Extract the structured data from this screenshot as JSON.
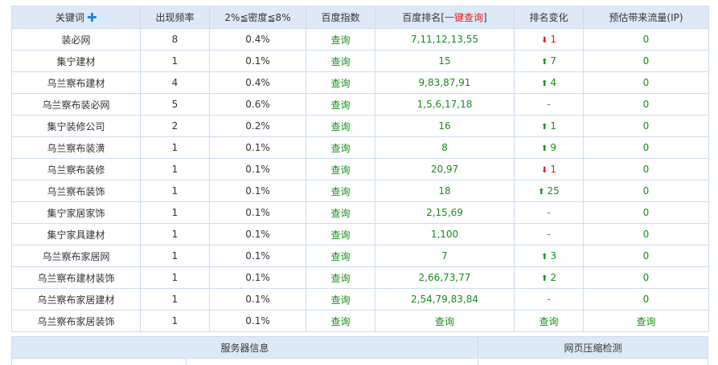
{
  "table": {
    "headers": {
      "keyword": "关键词",
      "frequency": "出现频率",
      "density": "2%≦密度≦8%",
      "baidu_index": "百度指数",
      "baidu_rank_prefix": "百度排名[",
      "baidu_rank_link": "一键查询",
      "baidu_rank_suffix": "]",
      "rank_change": "排名变化",
      "traffic": "预估带来流量(IP)"
    },
    "rows": [
      {
        "keyword": "装必网",
        "freq": "8",
        "density": "0.4%",
        "index": "查询",
        "rank": "7,11,12,13,55",
        "change_dir": "down",
        "change": "1",
        "traffic": "0"
      },
      {
        "keyword": "集宁建材",
        "freq": "1",
        "density": "0.1%",
        "index": "查询",
        "rank": "15",
        "change_dir": "up",
        "change": "7",
        "traffic": "0"
      },
      {
        "keyword": "乌兰察布建材",
        "freq": "4",
        "density": "0.4%",
        "index": "查询",
        "rank": "9,83,87,91",
        "change_dir": "up",
        "change": "4",
        "traffic": "0"
      },
      {
        "keyword": "乌兰察布装必网",
        "freq": "5",
        "density": "0.6%",
        "index": "查询",
        "rank": "1,5,6,17,18",
        "change_dir": "none",
        "change": "-",
        "traffic": "0"
      },
      {
        "keyword": "集宁装修公司",
        "freq": "2",
        "density": "0.2%",
        "index": "查询",
        "rank": "16",
        "change_dir": "up",
        "change": "1",
        "traffic": "0"
      },
      {
        "keyword": "乌兰察布装潢",
        "freq": "1",
        "density": "0.1%",
        "index": "查询",
        "rank": "8",
        "change_dir": "up",
        "change": "9",
        "traffic": "0"
      },
      {
        "keyword": "乌兰察布装修",
        "freq": "1",
        "density": "0.1%",
        "index": "查询",
        "rank": "20,97",
        "change_dir": "down",
        "change": "1",
        "traffic": "0"
      },
      {
        "keyword": "乌兰察布装饰",
        "freq": "1",
        "density": "0.1%",
        "index": "查询",
        "rank": "18",
        "change_dir": "up",
        "change": "25",
        "traffic": "0"
      },
      {
        "keyword": "集宁家居家饰",
        "freq": "1",
        "density": "0.1%",
        "index": "查询",
        "rank": "2,15,69",
        "change_dir": "none",
        "change": "-",
        "traffic": "0"
      },
      {
        "keyword": "集宁家具建材",
        "freq": "1",
        "density": "0.1%",
        "index": "查询",
        "rank": "1,100",
        "change_dir": "none",
        "change": "-",
        "traffic": "0"
      },
      {
        "keyword": "乌兰察布家居网",
        "freq": "1",
        "density": "0.1%",
        "index": "查询",
        "rank": "7",
        "change_dir": "up",
        "change": "3",
        "traffic": "0"
      },
      {
        "keyword": "乌兰察布建材装饰",
        "freq": "1",
        "density": "0.1%",
        "index": "查询",
        "rank": "2,66,73,77",
        "change_dir": "up",
        "change": "2",
        "traffic": "0"
      },
      {
        "keyword": "乌兰察布家居建材",
        "freq": "1",
        "density": "0.1%",
        "index": "查询",
        "rank": "2,54,79,83,84",
        "change_dir": "none",
        "change": "-",
        "traffic": "0"
      },
      {
        "keyword": "乌兰察布家居装饰",
        "freq": "1",
        "density": "0.1%",
        "index": "查询",
        "rank_link": "查询",
        "change_dir": "link",
        "change": "查询",
        "traffic_link": "查询"
      }
    ]
  },
  "panels": {
    "server_info": "服务器信息",
    "compression_check": "网页压缩检测"
  },
  "icons": {
    "add": "plus-icon",
    "up": "arrow-up-icon",
    "down": "arrow-down-icon"
  },
  "colors": {
    "header_bg": "#dde9f7",
    "border": "#cddcee",
    "green": "#1a8c1a",
    "red": "#e11c1c",
    "accent_blue": "#2b86d8"
  }
}
